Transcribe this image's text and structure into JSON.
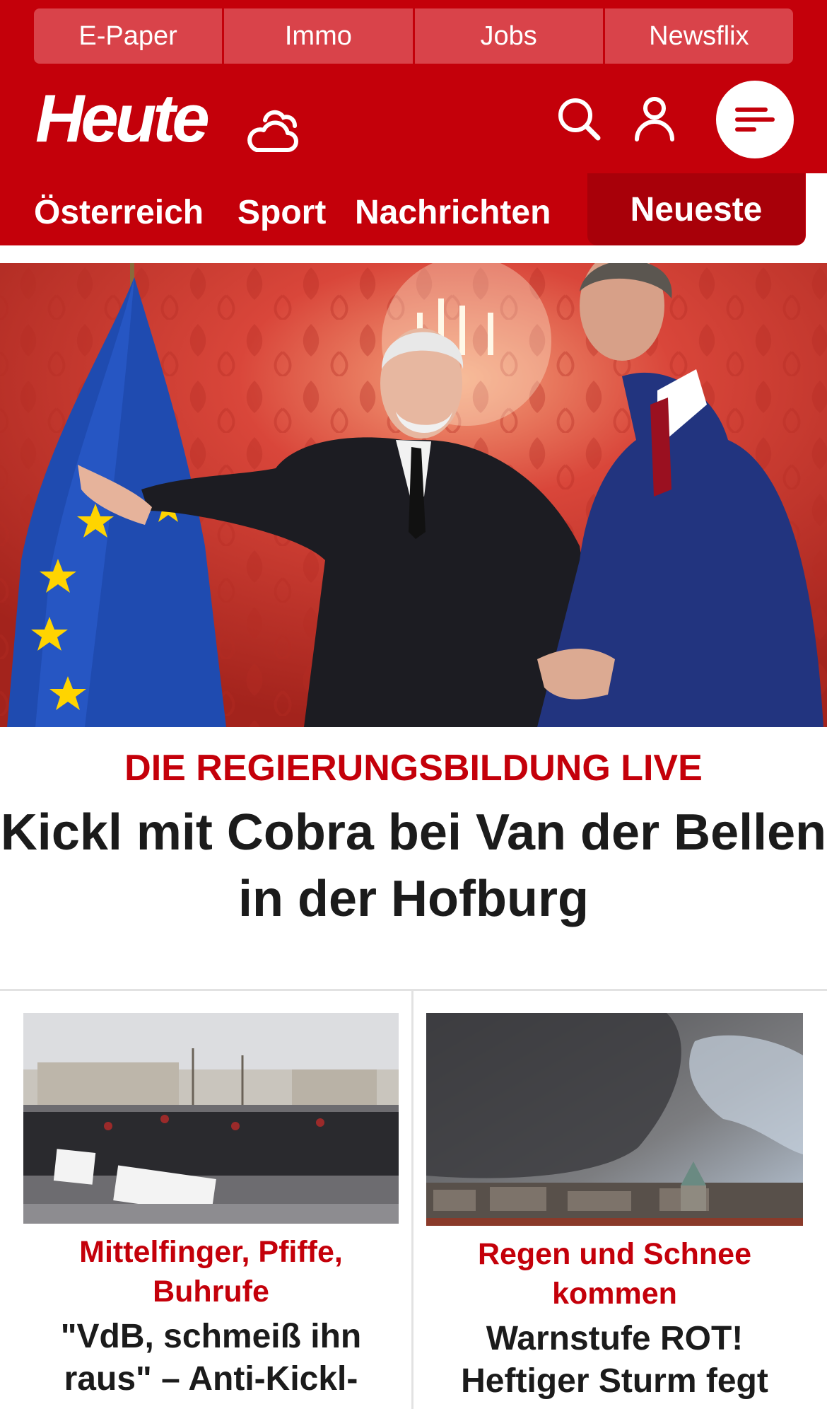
{
  "service_links": [
    "E-Paper",
    "Immo",
    "Jobs",
    "Newsflix"
  ],
  "brand": {
    "logo_text": "Heute"
  },
  "icons": {
    "weather": "cloud-icon",
    "search": "search-icon",
    "account": "user-icon",
    "menu": "hamburger-menu-icon"
  },
  "nav": {
    "items": [
      "Österreich",
      "Sport",
      "Nachrichten"
    ],
    "highlight": "Neueste"
  },
  "hero": {
    "kicker": "DIE REGIERUNGSBILDUNG LIVE",
    "title_line1": "Kickl mit Cobra bei Van der Bellen",
    "title_line2": "in der Hofburg"
  },
  "cards": [
    {
      "kicker_line1": "Mittelfinger, Pfiffe,",
      "kicker_line2": "Buhrufe",
      "title_line1": "\"VdB, schmeiß ihn",
      "title_line2": "raus\" – Anti-Kickl-"
    },
    {
      "kicker_line1": "Regen und Schnee",
      "kicker_line2": "kommen",
      "title_line1": "Warnstufe ROT!",
      "title_line2": "Heftiger Sturm fegt"
    }
  ],
  "colors": {
    "brand_red": "#c4000a",
    "dark_red": "#a80009",
    "text": "#1b1b1b"
  }
}
